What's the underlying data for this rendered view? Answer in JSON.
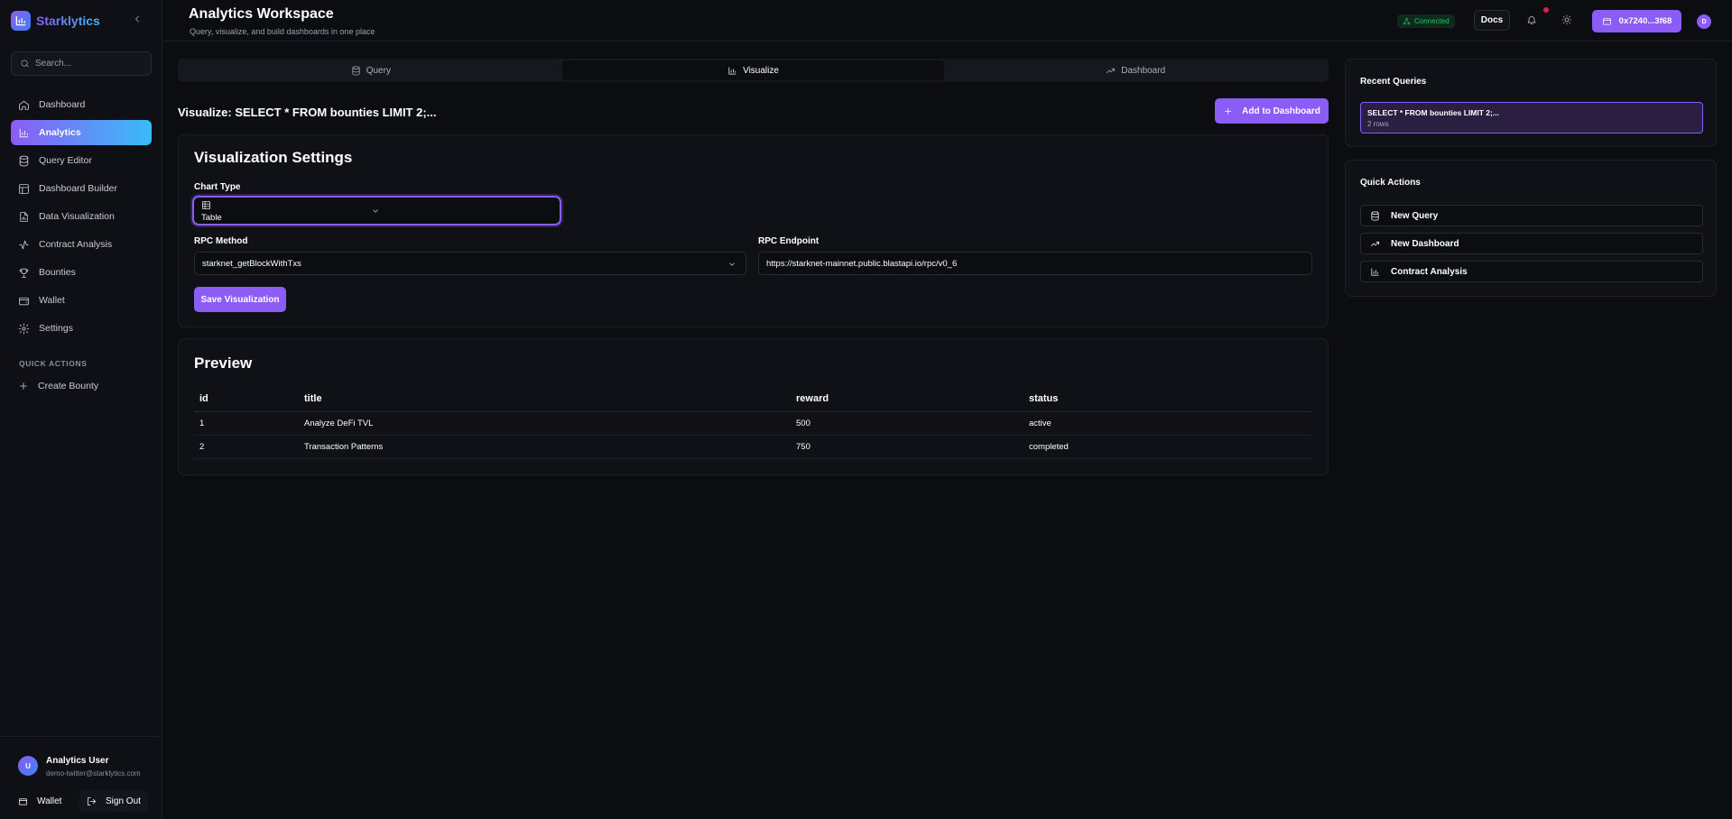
{
  "app": {
    "name": "Starklytics"
  },
  "sidebar": {
    "search_placeholder": "Search...",
    "items": [
      {
        "label": "Dashboard",
        "icon": "home-icon"
      },
      {
        "label": "Analytics",
        "icon": "bar-chart-icon",
        "active": true
      },
      {
        "label": "Query Editor",
        "icon": "database-icon"
      },
      {
        "label": "Dashboard Builder",
        "icon": "layout-icon"
      },
      {
        "label": "Data Visualization",
        "icon": "file-chart-icon"
      },
      {
        "label": "Contract Analysis",
        "icon": "activity-icon"
      },
      {
        "label": "Bounties",
        "icon": "trophy-icon"
      },
      {
        "label": "Wallet",
        "icon": "wallet-icon"
      },
      {
        "label": "Settings",
        "icon": "gear-icon"
      }
    ],
    "quick_actions_title": "QUICK ACTIONS",
    "quick_actions": [
      {
        "label": "Create Bounty",
        "icon": "plus-icon"
      }
    ],
    "user": {
      "initial": "U",
      "name": "Analytics User",
      "email": "demo-twitter@starklytics.com"
    },
    "footer": {
      "wallet_label": "Wallet",
      "signout_label": "Sign Out"
    }
  },
  "header": {
    "title": "Analytics Workspace",
    "subtitle": "Query, visualize, and build dashboards in one place",
    "status": "Connected",
    "docs_label": "Docs",
    "wallet_address": "0x7240...3f68",
    "avatar_initial": "D"
  },
  "tabs": [
    {
      "label": "Query",
      "icon": "database-icon"
    },
    {
      "label": "Visualize",
      "icon": "bar-chart-icon",
      "active": true
    },
    {
      "label": "Dashboard",
      "icon": "trending-icon"
    }
  ],
  "main": {
    "viz_title": "Visualize: SELECT * FROM bounties LIMIT 2;...",
    "add_to_dashboard_label": "Add to Dashboard",
    "settings": {
      "title": "Visualization Settings",
      "chart_type_label": "Chart Type",
      "chart_type_value": "Table",
      "rpc_method_label": "RPC Method",
      "rpc_method_value": "starknet_getBlockWithTxs",
      "rpc_endpoint_label": "RPC Endpoint",
      "rpc_endpoint_value": "https://starknet-mainnet.public.blastapi.io/rpc/v0_6",
      "save_label": "Save Visualization"
    },
    "preview": {
      "title": "Preview",
      "columns": [
        "id",
        "title",
        "reward",
        "status"
      ],
      "rows": [
        [
          "1",
          "Analyze DeFi TVL",
          "500",
          "active"
        ],
        [
          "2",
          "Transaction Patterns",
          "750",
          "completed"
        ]
      ]
    }
  },
  "right_panel": {
    "recent_title": "Recent Queries",
    "recent": [
      {
        "query": "SELECT * FROM bounties LIMIT 2;...",
        "rows": "2 rows"
      }
    ],
    "quick_title": "Quick Actions",
    "quick": [
      {
        "label": "New Query",
        "icon": "database-icon"
      },
      {
        "label": "New Dashboard",
        "icon": "trending-icon"
      },
      {
        "label": "Contract Analysis",
        "icon": "bar-chart-icon"
      }
    ]
  },
  "colors": {
    "accent": "#8b5cf6",
    "accent_secondary": "#38bdf8",
    "background": "#0b0d11",
    "success": "#22c55e",
    "notification": "#e11d48"
  }
}
